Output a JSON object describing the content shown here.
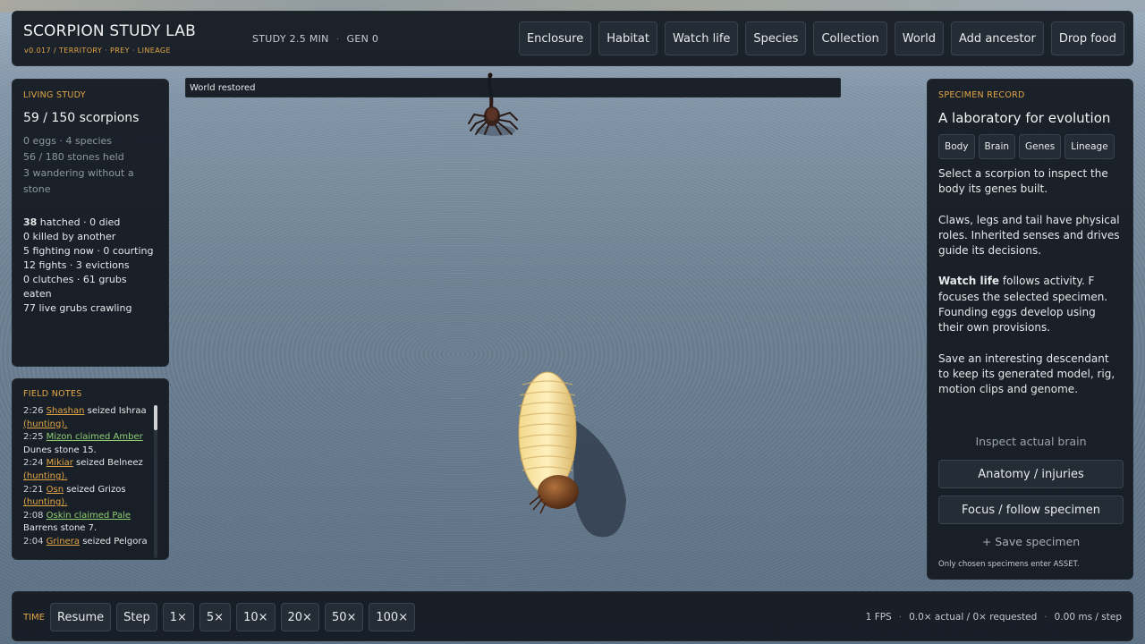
{
  "app": {
    "title": "SCORPION STUDY LAB",
    "subtitle": "v0.017  /  TERRITORY · PREY · LINEAGE",
    "study_time": "STUDY 2.5 MIN",
    "separator": "·",
    "generation": "GEN 0"
  },
  "nav": [
    {
      "label": "Enclosure"
    },
    {
      "label": "Habitat"
    },
    {
      "label": "Watch life"
    },
    {
      "label": "Species"
    },
    {
      "label": "Collection"
    },
    {
      "label": "World"
    },
    {
      "label": "Add ancestor"
    },
    {
      "label": "Drop food"
    }
  ],
  "living_study": {
    "heading": "LIVING STUDY",
    "count": "59 / 150 scorpions",
    "sub": [
      "0 eggs · 4 species",
      "56 / 180 stones held",
      "3 wandering without a stone"
    ],
    "hatched_count": "38",
    "hatched_rest": " hatched · 0 died",
    "stats": [
      "0 killed by another",
      "5 fighting now · 0 courting",
      "12 fights · 3 evictions",
      "0 clutches · 61 grubs eaten",
      "77 live grubs crawling"
    ]
  },
  "field_notes": {
    "heading": "FIELD NOTES",
    "entries": [
      {
        "time": "2:26",
        "name": "Shashan",
        "text": " seized Ishraa ",
        "tag": "(hunting)."
      },
      {
        "time": "2:25",
        "name": "Mizon claimed Amber",
        "text": " Dunes stone 15.",
        "tag": ""
      },
      {
        "time": "2:24",
        "name": "Mikiar",
        "text": " seized Belneez ",
        "tag": "(hunting)."
      },
      {
        "time": "2:21",
        "name": "Osn",
        "text": " seized Grizos ",
        "tag": "(hunting)."
      },
      {
        "time": "2:08",
        "name": "Oskin claimed Pale",
        "text": " Barrens stone 7.",
        "tag": ""
      },
      {
        "time": "2:04",
        "name": "Grinera",
        "text": " seized Pelgora",
        "tag": ""
      }
    ]
  },
  "banner": {
    "text": "World restored"
  },
  "record": {
    "heading": "SPECIMEN RECORD",
    "title": "A laboratory for evolution",
    "tabs": [
      {
        "label": "Body"
      },
      {
        "label": "Brain"
      },
      {
        "label": "Genes"
      },
      {
        "label": "Lineage"
      }
    ],
    "para1": "Select a scorpion to inspect the body its genes built.",
    "para2": "Claws, legs and tail have physical roles. Inherited senses and drives guide its decisions.",
    "para3_bold": "Watch life",
    "para3_rest": " follows activity. F focuses the selected specimen. Founding eggs develop using their own provisions.",
    "para4": "Save an interesting descendant to keep its generated model, rig, motion clips and genome.",
    "inspect_brain": "Inspect actual brain",
    "anatomy_btn": "Anatomy / injuries",
    "focus_btn": "Focus / follow specimen",
    "save_specimen": "+ Save specimen",
    "save_note": "Only chosen specimens enter ASSET."
  },
  "time": {
    "label": "TIME",
    "controls": [
      {
        "label": "Resume"
      },
      {
        "label": "Step"
      },
      {
        "label": "1×"
      },
      {
        "label": "5×"
      },
      {
        "label": "10×"
      },
      {
        "label": "20×"
      },
      {
        "label": "50×"
      },
      {
        "label": "100×"
      }
    ],
    "fps": "1 FPS",
    "rate": "0.0× actual / 0× requested",
    "step_time": "0.00 ms / step"
  },
  "colors": {
    "accent": "#e2a646",
    "link_green": "#8ecf74",
    "panel_bg": "#141a21",
    "ground": "#6f8396"
  }
}
